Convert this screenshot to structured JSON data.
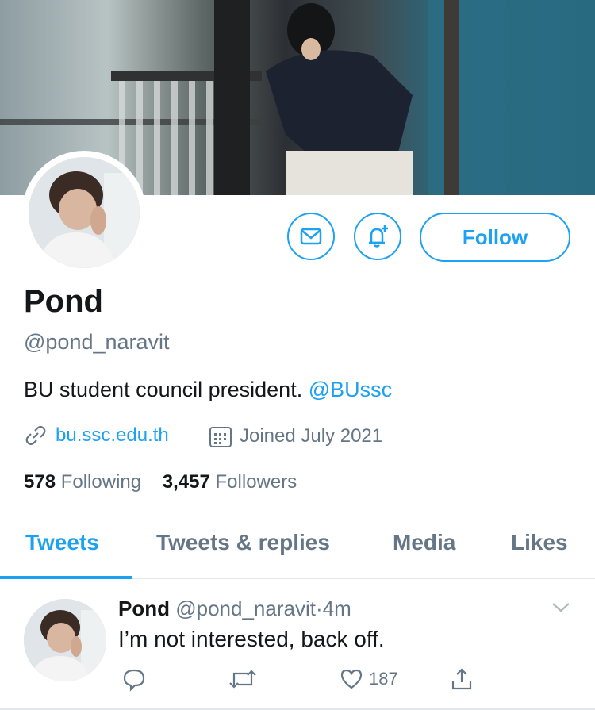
{
  "profile": {
    "name": "Pond",
    "handle": "@pond_naravit",
    "bio_text": "BU student council president.",
    "bio_mention": "@BUssc",
    "website": "bu.ssc.edu.th",
    "joined": "Joined July 2021",
    "following_count": "578",
    "following_label": "Following",
    "followers_count": "3,457",
    "followers_label": "Followers"
  },
  "actions": {
    "follow_label": "Follow",
    "message_icon": "envelope-icon",
    "notify_icon": "bell-plus-icon"
  },
  "tabs": [
    {
      "label": "Tweets",
      "active": true
    },
    {
      "label": "Tweets & replies",
      "active": false
    },
    {
      "label": "Media",
      "active": false
    },
    {
      "label": "Likes",
      "active": false
    }
  ],
  "tweet": {
    "author": "Pond",
    "handle": "@pond_naravit",
    "separator": "·",
    "time": "4m",
    "text": "I’m not interested, back off.",
    "likes": "187"
  },
  "colors": {
    "accent": "#1da1f2",
    "secondary_text": "#657786",
    "primary_text": "#14171a"
  }
}
